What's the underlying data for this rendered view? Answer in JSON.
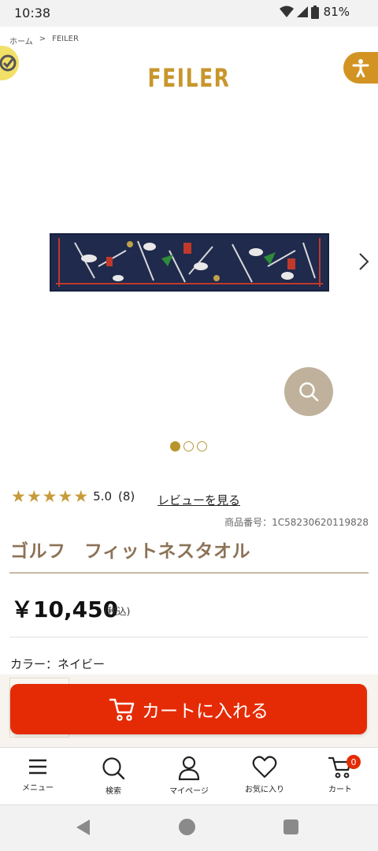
{
  "status_bar": {
    "time": "10:38",
    "battery": "81%"
  },
  "breadcrumb": {
    "items": [
      "ホーム",
      ">",
      "FEILER"
    ]
  },
  "brand": {
    "name": "FEILER",
    "color": "#c8962c"
  },
  "product": {
    "rating_score": "5.0",
    "rating_count": "(8)",
    "review_link": "レビューを見る",
    "code": "商品番号：1C58230620119828",
    "title": "ゴルフ　フィットネスタオル",
    "price": "￥10,450",
    "tax_note": "(税込)",
    "color_label": "カラー：ネイビー",
    "stars": 5
  },
  "carousel": {
    "count": 3,
    "active": 0
  },
  "cart_button": {
    "label": "カートに入れる",
    "color": "#e52b05"
  },
  "bottom_nav": {
    "menu": "メニュー",
    "search": "検索",
    "mypage": "マイページ",
    "favorites": "お気に入り",
    "cart": "カート",
    "cart_count": "0"
  },
  "icons": [
    "accessibility-icon",
    "search-icon",
    "chevron-right-icon",
    "cart-icon",
    "menu-icon",
    "user-icon",
    "heart-icon"
  ]
}
